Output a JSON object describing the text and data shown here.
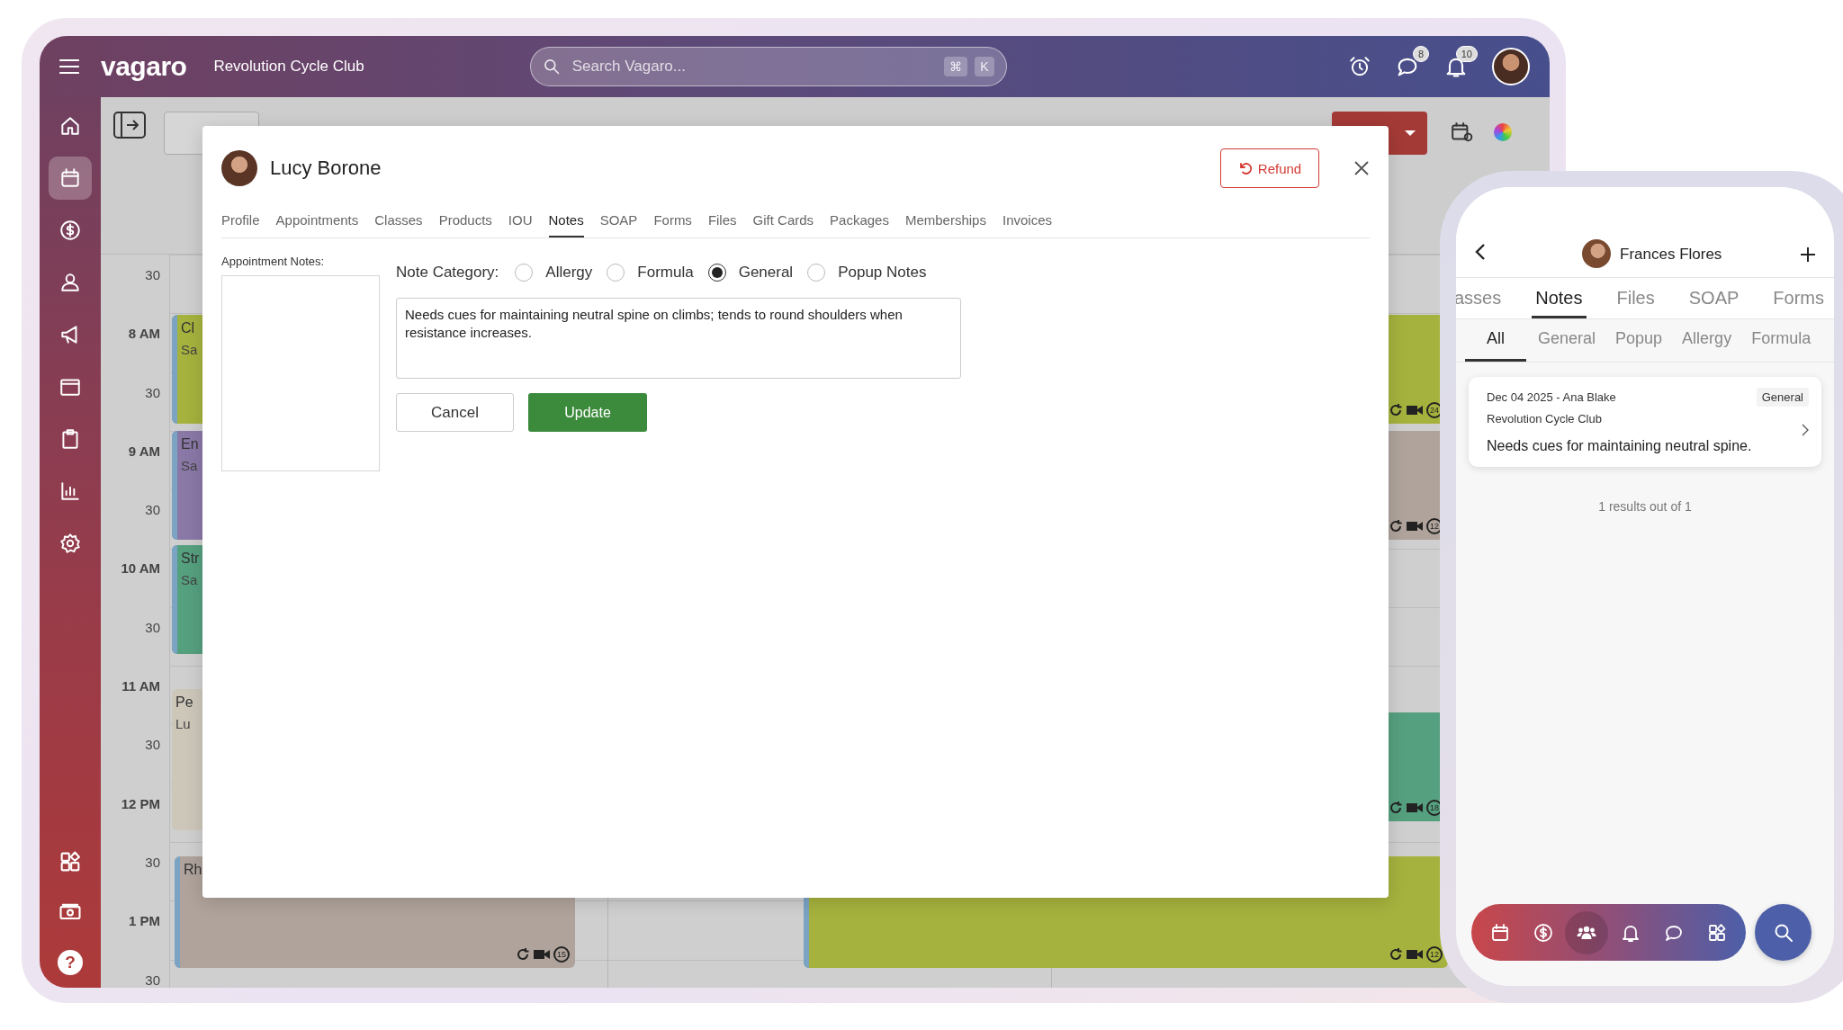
{
  "topbar": {
    "logo": "vagaro",
    "business": "Revolution Cycle Club",
    "search": {
      "placeholder": "Search Vagaro...",
      "keys": [
        "⌘",
        "K"
      ]
    },
    "chat_badge": "8",
    "notification_badge": "10"
  },
  "sidebar": {
    "items": [
      {
        "kind": "home",
        "selected": false
      },
      {
        "kind": "calendar",
        "selected": true
      },
      {
        "kind": "dollar",
        "selected": false
      },
      {
        "kind": "person",
        "selected": false
      },
      {
        "kind": "megaphone",
        "selected": false
      },
      {
        "kind": "browser",
        "selected": false
      },
      {
        "kind": "clipboard",
        "selected": false
      },
      {
        "kind": "chart",
        "selected": false
      },
      {
        "kind": "gear",
        "selected": false
      }
    ],
    "bottom": [
      {
        "kind": "apps"
      },
      {
        "kind": "cash"
      },
      {
        "kind": "help",
        "label": "?"
      }
    ]
  },
  "calendar": {
    "times": [
      "30",
      "8 AM",
      "30",
      "9 AM",
      "30",
      "10 AM",
      "30",
      "11 AM",
      "30",
      "12 PM",
      "30",
      "1 PM",
      "30"
    ],
    "events": [
      {
        "title": "Cl",
        "subtitle": "Sa",
        "color": "#a5b23d",
        "stripe": true
      },
      {
        "title": "En",
        "subtitle": "Sa",
        "color": "#8a78a7",
        "stripe": true
      },
      {
        "title": "Str",
        "subtitle": "Sa",
        "color": "#55a07e",
        "stripe": true
      },
      {
        "title": "Pe",
        "subtitle": "Lu",
        "color": "#cdc7ba",
        "stripe": false
      },
      {
        "title": "Rh",
        "color": "#afa39b",
        "stripe": true,
        "counter": "15"
      },
      {
        "color": "#a5b23d",
        "stripe": false,
        "counter": "24"
      },
      {
        "color": "#afa39b",
        "stripe": false,
        "counter": "12"
      },
      {
        "color": "#55a07e",
        "stripe": false,
        "counter": "18"
      },
      {
        "color": "#a5b23d",
        "stripe": true,
        "counter": "12"
      }
    ]
  },
  "modal": {
    "client": "Lucy Borone",
    "refund": "Refund",
    "tabs": [
      {
        "label": "Profile",
        "selected": false
      },
      {
        "label": "Appointments",
        "selected": false
      },
      {
        "label": "Classes",
        "selected": false
      },
      {
        "label": "Products",
        "selected": false
      },
      {
        "label": "IOU",
        "selected": false
      },
      {
        "label": "Notes",
        "selected": true
      },
      {
        "label": "SOAP",
        "selected": false
      },
      {
        "label": "Forms",
        "selected": false
      },
      {
        "label": "Files",
        "selected": false
      },
      {
        "label": "Gift Cards",
        "selected": false
      },
      {
        "label": "Packages",
        "selected": false
      },
      {
        "label": "Memberships",
        "selected": false
      },
      {
        "label": "Invoices",
        "selected": false
      }
    ],
    "appointment_notes_label": "Appointment Notes:",
    "category_label": "Note Category:",
    "categories": [
      {
        "label": "Allergy",
        "selected": false
      },
      {
        "label": "Formula",
        "selected": false
      },
      {
        "label": "General",
        "selected": true
      },
      {
        "label": "Popup Notes",
        "selected": false
      }
    ],
    "note": "Needs cues for maintaining neutral spine on climbs; tends to round shoulders when resistance increases.",
    "cancel": "Cancel",
    "update": "Update"
  },
  "phone": {
    "client": "Frances Flores",
    "tabs": [
      {
        "label": "asses",
        "selected": false
      },
      {
        "label": "Notes",
        "selected": true
      },
      {
        "label": "Files",
        "selected": false
      },
      {
        "label": "SOAP",
        "selected": false
      },
      {
        "label": "Forms",
        "selected": false
      }
    ],
    "filters": [
      {
        "label": "All",
        "selected": true
      },
      {
        "label": "General",
        "selected": false
      },
      {
        "label": "Popup",
        "selected": false
      },
      {
        "label": "Allergy",
        "selected": false
      },
      {
        "label": "Formula",
        "selected": false
      }
    ],
    "note_card": {
      "meta": "Dec 04 2025 - Ana Blake",
      "category": "General",
      "location": "Revolution Cycle Club",
      "text": "Needs cues for maintaining neutral spine."
    },
    "results": "1 results out of 1",
    "nav": [
      {
        "kind": "calendar",
        "selected": false
      },
      {
        "kind": "dollar",
        "selected": false
      },
      {
        "kind": "people",
        "selected": true
      },
      {
        "kind": "bell",
        "selected": false
      },
      {
        "kind": "chat",
        "selected": false
      },
      {
        "kind": "apps",
        "selected": false
      }
    ]
  }
}
